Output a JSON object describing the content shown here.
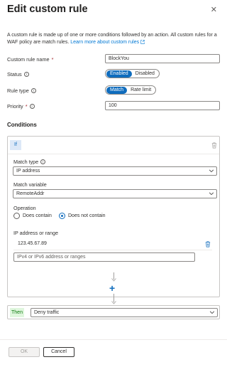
{
  "header": {
    "title": "Edit custom rule",
    "close_glyph": "✕"
  },
  "description": {
    "text": "A custom rule is made up of one or more conditions followed by an action. All custom rules for a WAF policy are match rules.",
    "link": "Learn more about custom rules",
    "link_icon": "external-link-icon"
  },
  "form": {
    "name_label": "Custom rule name",
    "name_required": "*",
    "name_value": "BlockYou",
    "status_label": "Status",
    "status_options": [
      "Enabled",
      "Disabled"
    ],
    "status_selected": "Enabled",
    "ruletype_label": "Rule type",
    "ruletype_options": [
      "Match",
      "Rate limit"
    ],
    "ruletype_selected": "Match",
    "priority_label": "Priority",
    "priority_required": "*",
    "priority_value": "100"
  },
  "conditions": {
    "title": "Conditions",
    "if_tag": "If",
    "match_type_label": "Match type",
    "match_type_value": "IP address",
    "match_variable_label": "Match variable",
    "match_variable_value": "RemoteAddr",
    "operation_label": "Operation",
    "operation_options": [
      "Does contain",
      "Does not contain"
    ],
    "operation_selected": "Does not contain",
    "ip_label": "IP address or range",
    "ip_values": [
      "123.45.67.89"
    ],
    "ip_placeholder": "IPv4 or IPv6 address or ranges"
  },
  "action": {
    "then_tag": "Then",
    "value": "Deny traffic"
  },
  "footer": {
    "ok_label": "OK",
    "cancel_label": "Cancel"
  },
  "colors": {
    "accent": "#0f6cbd",
    "then_green": "#107c10",
    "link": "#0078d4"
  }
}
